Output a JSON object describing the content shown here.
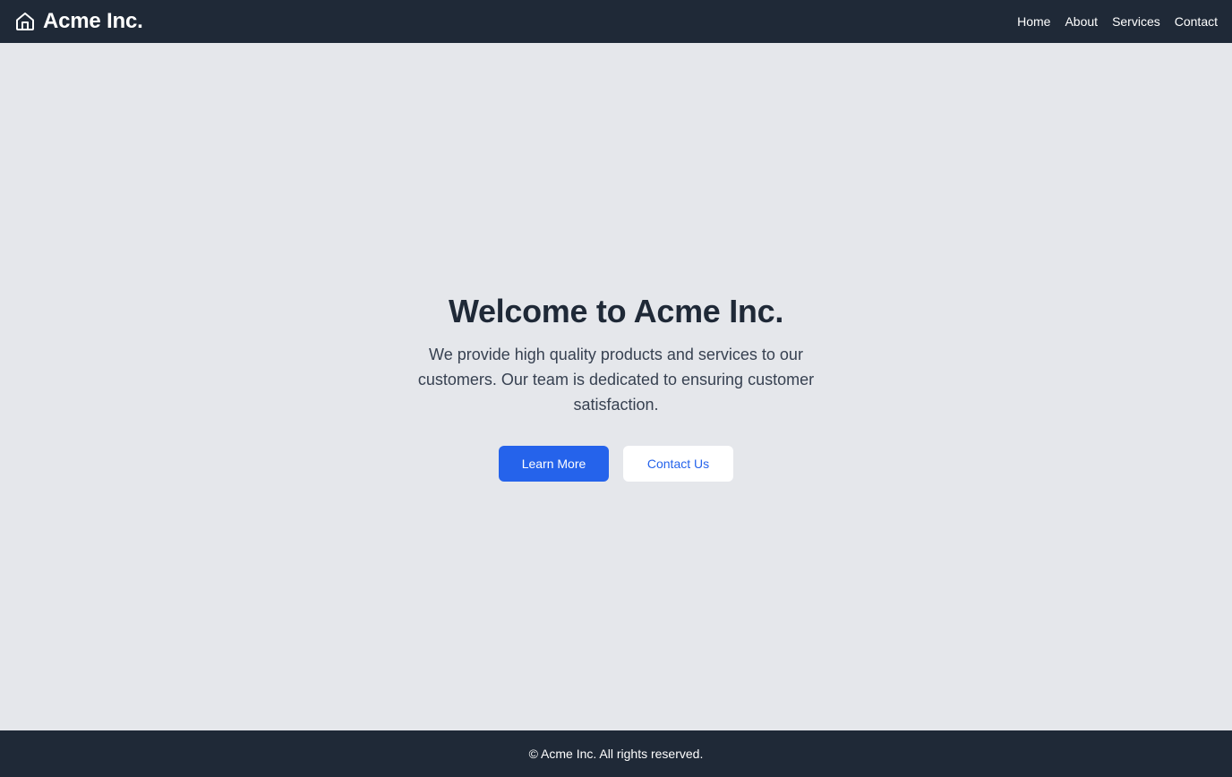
{
  "header": {
    "brand_name": "Acme Inc.",
    "brand_icon": "home-icon",
    "nav": [
      {
        "label": "Home"
      },
      {
        "label": "About"
      },
      {
        "label": "Services"
      },
      {
        "label": "Contact"
      }
    ]
  },
  "hero": {
    "title": "Welcome to Acme Inc.",
    "description": "We provide high quality products and services to our customers. Our team is dedicated to ensuring customer satisfaction.",
    "primary_button": "Learn More",
    "secondary_button": "Contact Us"
  },
  "footer": {
    "copyright": "© Acme Inc. All rights reserved."
  },
  "colors": {
    "header_bg": "#1f2937",
    "page_bg": "#e5e7eb",
    "accent": "#2563eb",
    "title": "#1f2937"
  }
}
